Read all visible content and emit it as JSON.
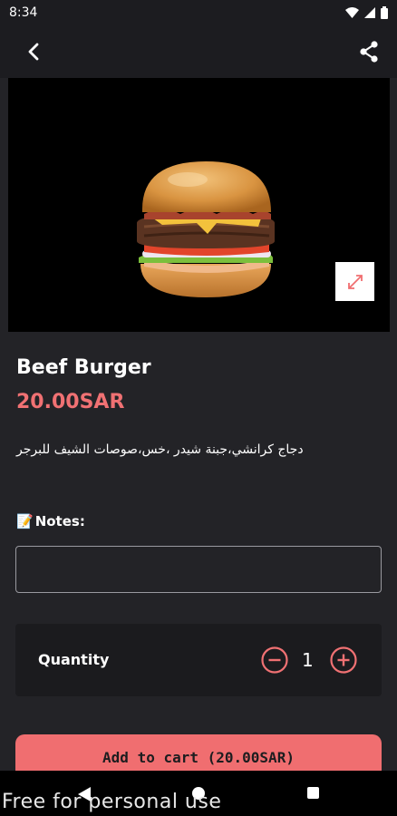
{
  "status_bar": {
    "time": "8:34"
  },
  "product": {
    "name": "Beef Burger",
    "price": "20.00SAR",
    "description": "دجاج كرانشي،جبنة شيدر ،خس،صوصات الشيف للبرجر"
  },
  "notes": {
    "icon": "📝",
    "label": "Notes:",
    "value": ""
  },
  "quantity": {
    "label": "Quantity",
    "value": "1"
  },
  "cart": {
    "button_label": "Add to cart (20.00SAR)"
  },
  "watermark": "Free for personal use",
  "colors": {
    "accent": "#f07173",
    "background": "#232327",
    "button": "#f06e70"
  }
}
